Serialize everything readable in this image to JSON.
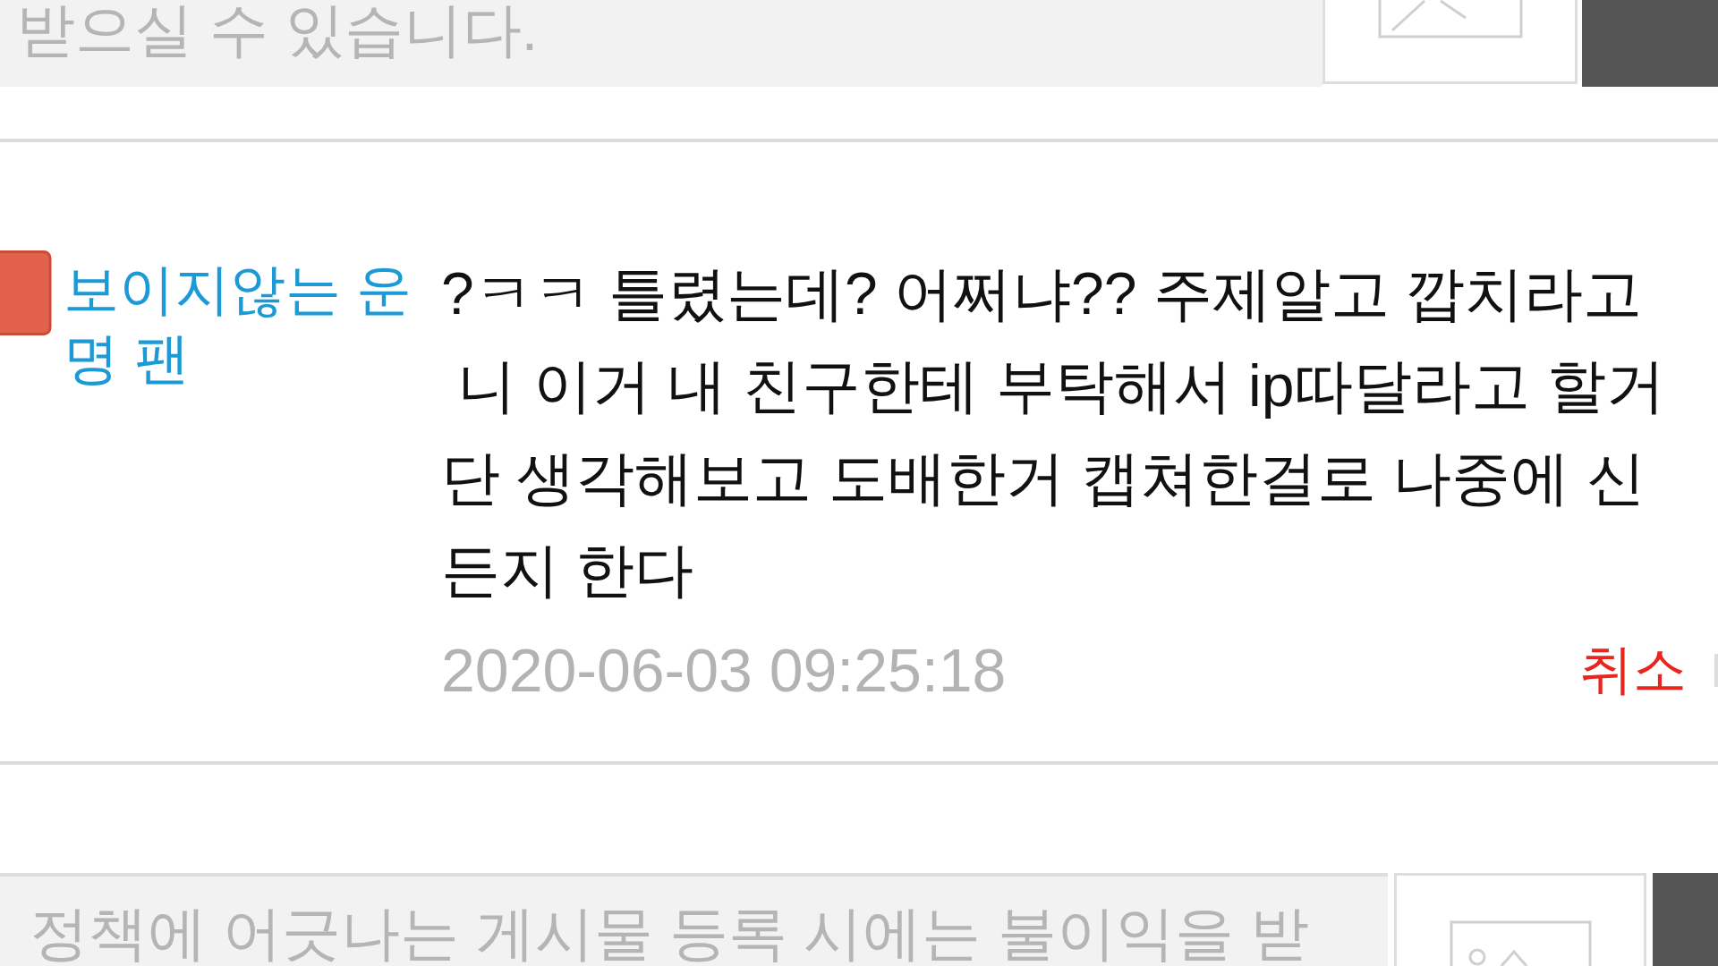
{
  "comment_input_top": {
    "placeholder": "받으실 수 있습니다."
  },
  "comment": {
    "author": "보이지않는 운명 팬",
    "body_lines": [
      "?ㅋㅋ 틀렸는데? 어쩌냐?? 주제알고 깝치라고",
      " 니 이거 내 친구한테 부탁해서 ip따달라고 할거",
      "단 생각해보고 도배한거 캡쳐한걸로 나중에 신",
      "든지 한다"
    ],
    "timestamp": "2020-06-03 09:25:18",
    "cancel_label": "취소"
  },
  "comment_input_bottom": {
    "placeholder": "정책에 어긋나는 게시물 등록 시에는 불이익을 받"
  }
}
